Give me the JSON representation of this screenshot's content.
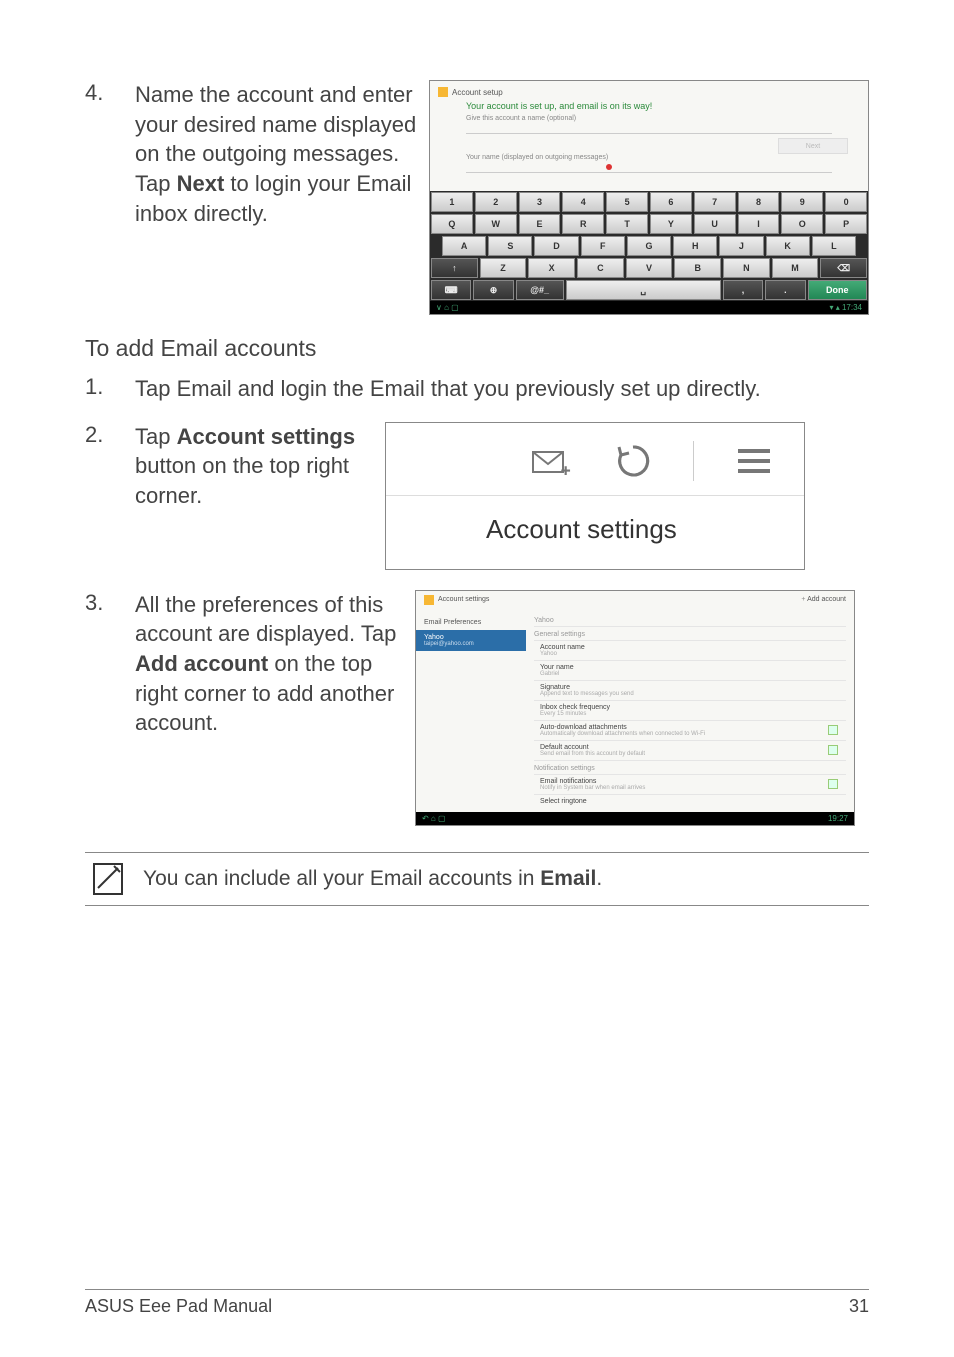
{
  "step4": {
    "num": "4.",
    "text_a": "Name the account and enter your desired name displayed on the outgoing messages. Tap ",
    "bold": "Next",
    "text_b": " to login your Email inbox directly."
  },
  "screenshot1": {
    "title": "Account setup",
    "green": "Your account is set up, and email is on its way!",
    "field1": "Give this account a name (optional)",
    "field2": "Your name (displayed on outgoing messages)",
    "next": "Next",
    "kb_r1": [
      "1",
      "2",
      "3",
      "4",
      "5",
      "6",
      "7",
      "8",
      "9",
      "0"
    ],
    "kb_r2": [
      "Q",
      "W",
      "E",
      "R",
      "T",
      "Y",
      "U",
      "I",
      "O",
      "P"
    ],
    "kb_r3": [
      "A",
      "S",
      "D",
      "F",
      "G",
      "H",
      "J",
      "K",
      "L"
    ],
    "kb_r4": [
      "↑",
      "Z",
      "X",
      "C",
      "V",
      "B",
      "N",
      "M",
      "⌫"
    ],
    "kb_r5": [
      "⌨",
      "⊕",
      "@#_",
      "␣",
      ",",
      ".",
      "Done"
    ],
    "time": "17:34"
  },
  "subhead": "To add Email accounts",
  "step1": {
    "num": "1.",
    "text": "Tap Email and login the Email that you previously set up directly."
  },
  "step2": {
    "num": "2.",
    "text_a": "Tap ",
    "bold": "Account settings",
    "text_b": " button on the top right corner."
  },
  "screenshot2": {
    "label": "Account settings"
  },
  "step3": {
    "num": "3.",
    "text_a": "All the preferences of this account are displayed. Tap ",
    "bold": "Add account",
    "text_b": " on the top right corner to add another account."
  },
  "screenshot3": {
    "title": "Account settings",
    "add": "Add account",
    "side_pref": "Email Preferences",
    "side_acc": "Yahoo",
    "side_acc_sub": "taipei@yahoo.com",
    "cat_yahoo": "Yahoo",
    "cat_general": "General settings",
    "items": [
      {
        "t": "Account name",
        "s": "Yahoo"
      },
      {
        "t": "Your name",
        "s": "Gabriel"
      },
      {
        "t": "Signature",
        "s": "Append text to messages you send"
      },
      {
        "t": "Inbox check frequency",
        "s": "Every 15 minutes"
      },
      {
        "t": "Auto-download attachments",
        "s": "Automatically download attachments when connected to Wi-Fi",
        "chk": true
      },
      {
        "t": "Default account",
        "s": "Send email from this account by default",
        "chk": true
      }
    ],
    "cat_notif": "Notification settings",
    "items2": [
      {
        "t": "Email notifications",
        "s": "Notify in System bar when email arrives",
        "chk": true
      },
      {
        "t": "Select ringtone",
        "s": ""
      }
    ],
    "time": "19:27"
  },
  "note": {
    "text_a": "You can include all your Email accounts in ",
    "bold": "Email",
    "text_b": "."
  },
  "footer": {
    "left": "ASUS Eee Pad Manual",
    "right": "31"
  }
}
